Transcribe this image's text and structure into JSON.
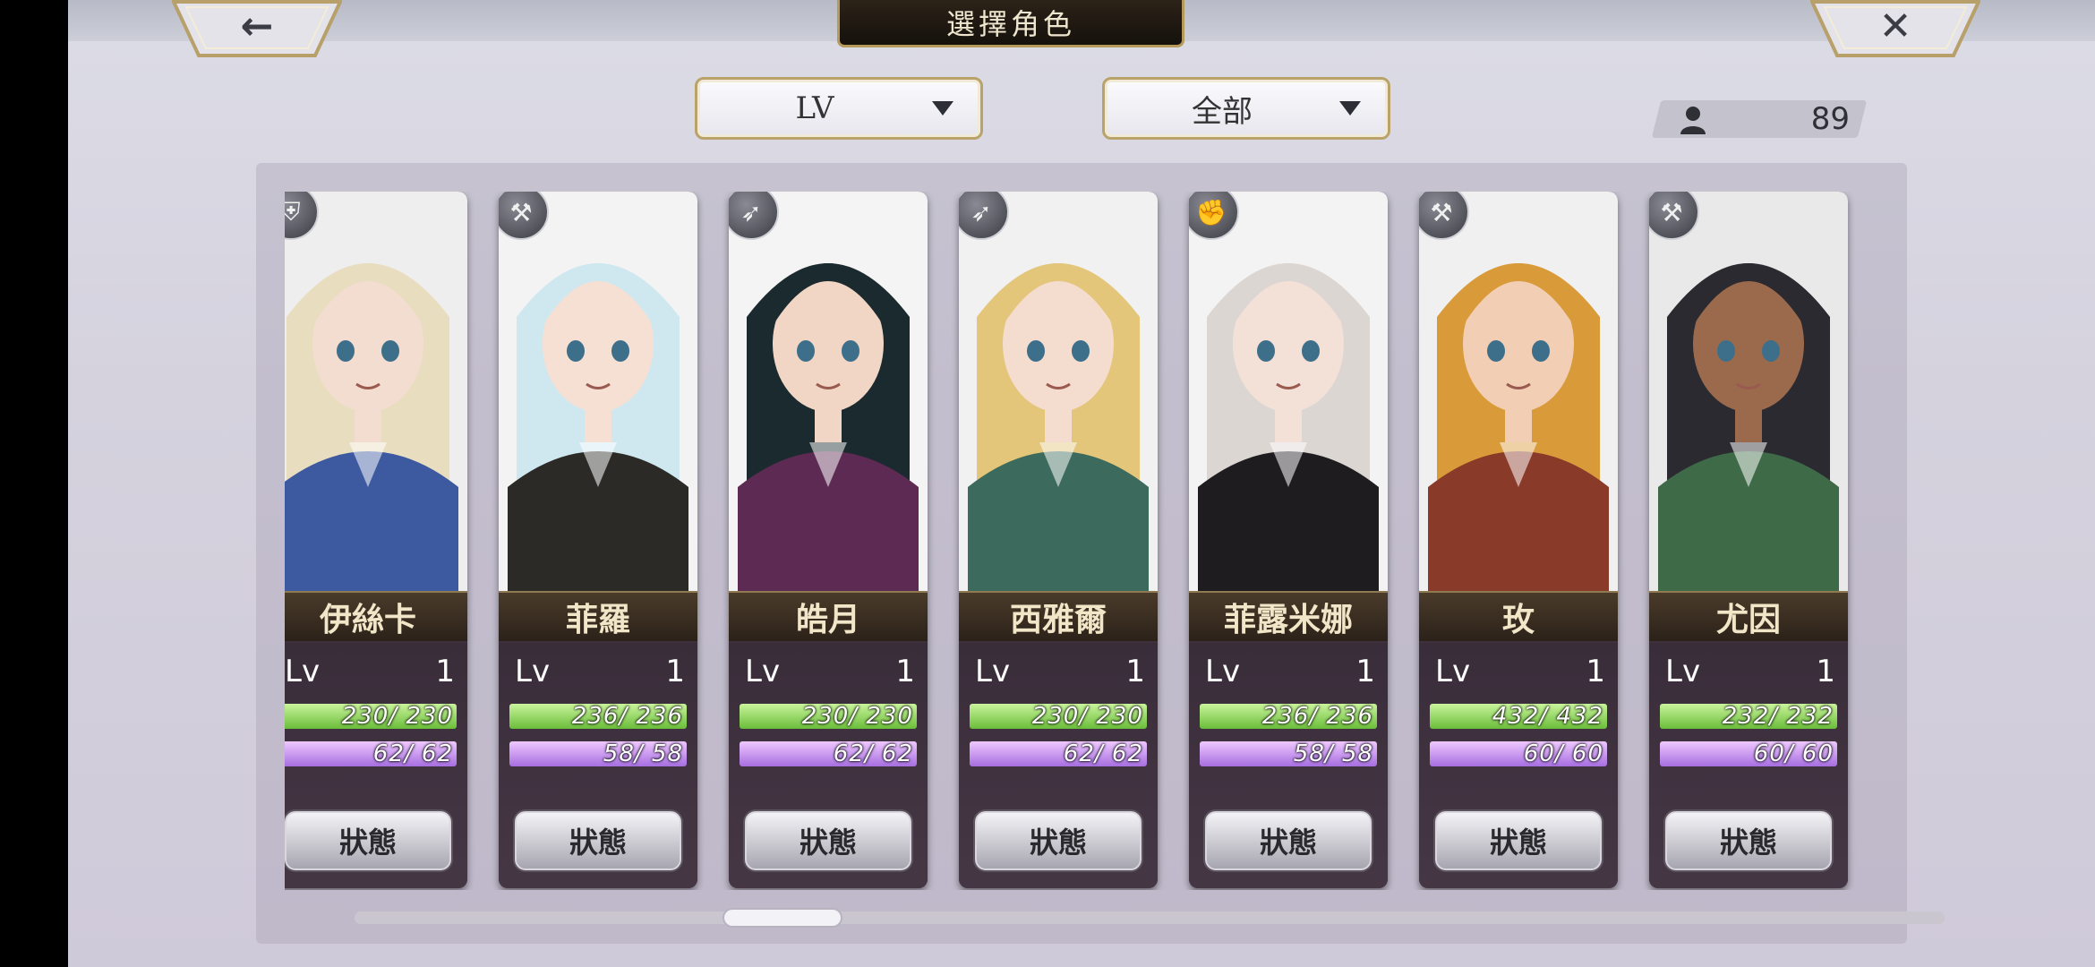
{
  "screen": {
    "title": "選擇角色",
    "back_icon": "arrow-left-icon",
    "close_icon": "close-icon"
  },
  "filters": {
    "sort_label": "LV",
    "category_label": "全部"
  },
  "roster": {
    "count_icon": "person-icon",
    "count": "89"
  },
  "characters": [
    {
      "name": "伊絲卡",
      "lv_label": "Lv",
      "level": "1",
      "hp_text": "230/ 230",
      "mp_text": "62/ 62",
      "hp_ratio": 1,
      "mp_ratio": 1,
      "button": "狀態",
      "weapon_icon": "shield-icon",
      "hair": "#e8ddbf",
      "skin": "#f3ddd0",
      "cloth": "#3d5aa0",
      "bg": "#eeeeee"
    },
    {
      "name": "菲羅",
      "lv_label": "Lv",
      "level": "1",
      "hp_text": "236/ 236",
      "mp_text": "58/ 58",
      "hp_ratio": 1,
      "mp_ratio": 1,
      "button": "狀態",
      "weapon_icon": "axe-icon",
      "hair": "#cfe8ef",
      "skin": "#f6e0d4",
      "cloth": "#2b2a26",
      "bg": "#f3f3f3"
    },
    {
      "name": "皓月",
      "lv_label": "Lv",
      "level": "1",
      "hp_text": "230/ 230",
      "mp_text": "62/ 62",
      "hp_ratio": 1,
      "mp_ratio": 1,
      "button": "狀態",
      "weapon_icon": "bow-icon",
      "hair": "#1b2a2e",
      "skin": "#f1d6c6",
      "cloth": "#5c2a52",
      "bg": "#f4f4f4"
    },
    {
      "name": "西雅爾",
      "lv_label": "Lv",
      "level": "1",
      "hp_text": "230/ 230",
      "mp_text": "62/ 62",
      "hp_ratio": 1,
      "mp_ratio": 1,
      "button": "狀態",
      "weapon_icon": "bow-icon",
      "hair": "#e3c67a",
      "skin": "#f4ddcf",
      "cloth": "#3c6a5c",
      "bg": "#f1f1f1"
    },
    {
      "name": "菲露米娜",
      "lv_label": "Lv",
      "level": "1",
      "hp_text": "236/ 236",
      "mp_text": "58/ 58",
      "hp_ratio": 1,
      "mp_ratio": 1,
      "button": "狀態",
      "weapon_icon": "gauntlet-icon",
      "hair": "#dcd6d2",
      "skin": "#f3e1d8",
      "cloth": "#1f1c1f",
      "bg": "#f3f3f3"
    },
    {
      "name": "玫",
      "lv_label": "Lv",
      "level": "1",
      "hp_text": "432/ 432",
      "mp_text": "60/ 60",
      "hp_ratio": 1,
      "mp_ratio": 1,
      "button": "狀態",
      "weapon_icon": "hammer-icon",
      "hair": "#d99b3a",
      "skin": "#f2cfb4",
      "cloth": "#8a3a28",
      "bg": "#f0f0f0"
    },
    {
      "name": "尤因",
      "lv_label": "Lv",
      "level": "1",
      "hp_text": "232/ 232",
      "mp_text": "60/ 60",
      "hp_ratio": 1,
      "mp_ratio": 1,
      "button": "狀態",
      "weapon_icon": "hammer-icon",
      "hair": "#2a2a30",
      "skin": "#9b6a4c",
      "cloth": "#3f6a48",
      "bg": "#e9e9e9"
    }
  ],
  "scroll": {
    "position": 0.25
  }
}
